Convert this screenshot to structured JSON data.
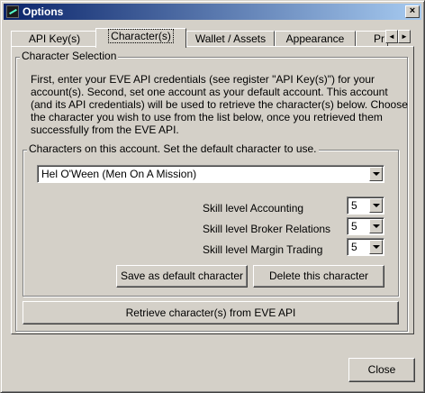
{
  "window": {
    "title": "Options",
    "close_glyph": "×",
    "icon": "app-icon"
  },
  "tabs": [
    {
      "label": "API Key(s)"
    },
    {
      "label": "Character(s)",
      "active": true
    },
    {
      "label": "Wallet / Assets"
    },
    {
      "label": "Appearance"
    },
    {
      "label": "Pr"
    }
  ],
  "tab_scroll": {
    "left": "◄",
    "right": "►"
  },
  "character_selection": {
    "legend": "Character Selection",
    "description": "First, enter your EVE API credentials (see register \"API Key(s)\") for your account(s). Second, set one account as your default account. This account (and its API credentials) will be used to retrieve the character(s) below. Choose the character you wish to use from the list below, once you retrieved them successfully from the EVE API."
  },
  "characters": {
    "legend": "Characters on this account. Set the default character to use.",
    "selected_character": "Hel O'Ween (Men On A Mission)",
    "skills": [
      {
        "label": "Skill level Accounting",
        "value": "5"
      },
      {
        "label": "Skill level Broker Relations",
        "value": "5"
      },
      {
        "label": "Skill level Margin Trading",
        "value": "5"
      }
    ],
    "save_default_label": "Save as default character",
    "delete_label": "Delete this character"
  },
  "retrieve_label": "Retrieve character(s) from EVE API",
  "close_label": "Close"
}
